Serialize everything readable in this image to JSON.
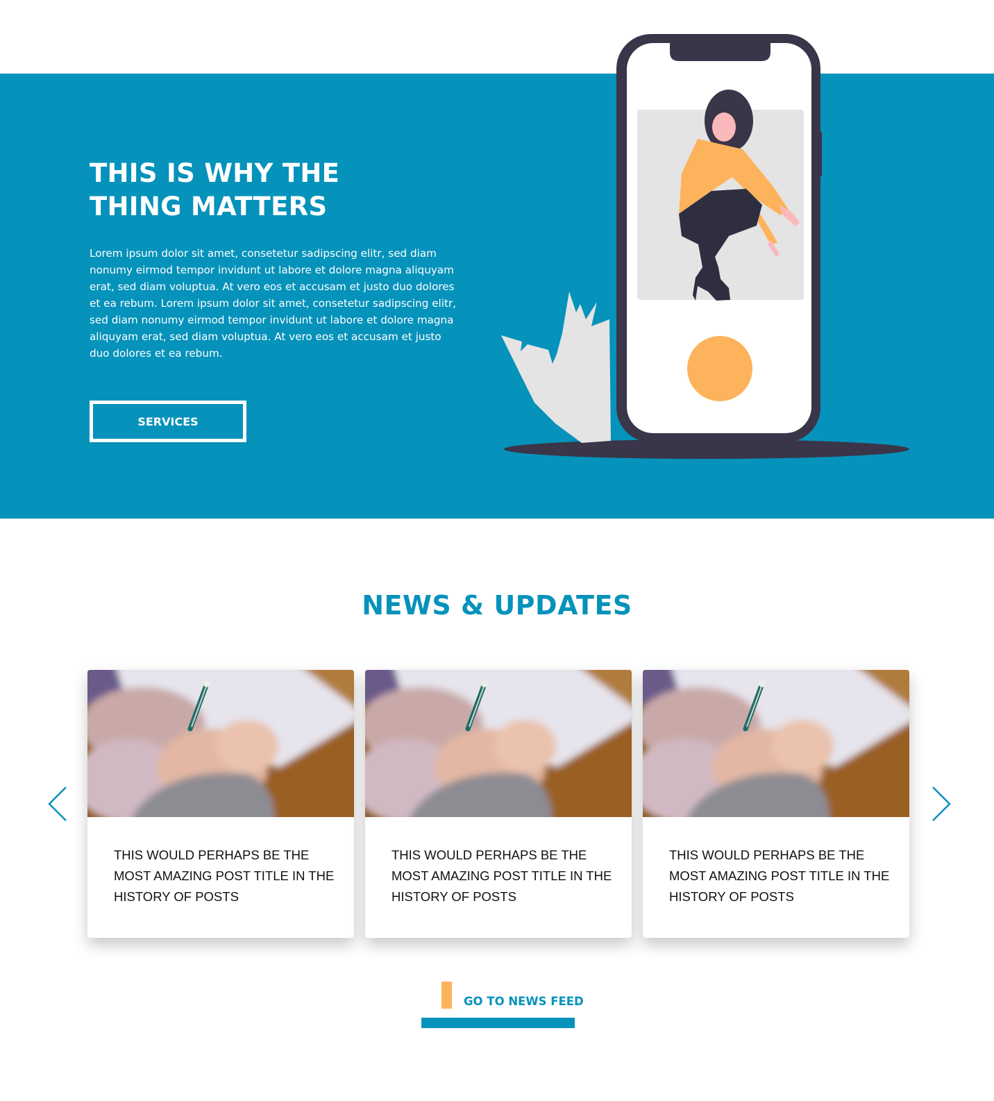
{
  "colors": {
    "primary": "#0592bb",
    "accent": "#fdb35b",
    "dark": "#3a3548",
    "white": "#ffffff"
  },
  "hero": {
    "title_line1": "THIS IS WHY THE",
    "title_line2": "THING MATTERS",
    "body": "Lorem ipsum dolor sit amet, consetetur sadipscing elitr, sed diam nonumy eirmod tempor invidunt ut labore et dolore magna aliquyam erat, sed diam voluptua. At vero eos et accusam et justo duo dolores et ea rebum. Lorem ipsum dolor sit amet, consetetur sadipscing elitr, sed diam nonumy eirmod tempor invidunt ut labore et dolore magna aliquyam erat, sed diam voluptua. At vero eos et accusam et justo duo dolores et ea rebum.",
    "button_label": "SERVICES"
  },
  "news": {
    "section_title": "NEWS & UPDATES",
    "cards": [
      {
        "title": "THIS WOULD PERHAPS BE THE MOST AMAZING POST TITLE IN THE HISTORY OF POSTS"
      },
      {
        "title": "THIS WOULD PERHAPS BE THE MOST AMAZING POST TITLE IN THE HISTORY OF POSTS"
      },
      {
        "title": "THIS WOULD PERHAPS BE THE MOST AMAZING POST TITLE IN THE HISTORY OF POSTS"
      }
    ],
    "prev_icon": "chevron-left-icon",
    "next_icon": "chevron-right-icon",
    "feed_link_label": "GO TO NEWS FEED"
  }
}
